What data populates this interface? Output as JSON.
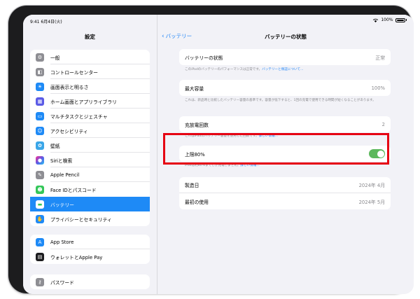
{
  "status_bar": {
    "time": "9:41  6月4日(火)",
    "battery": "100%"
  },
  "sidebar": {
    "title": "設定",
    "groups": [
      [
        {
          "label": "一般",
          "icon": "gear-icon",
          "color": "#8e8e93"
        },
        {
          "label": "コントロールセンター",
          "icon": "control-center-icon",
          "color": "#8e8e93"
        },
        {
          "label": "画面表示と明るさ",
          "icon": "brightness-icon",
          "color": "#1e8af6"
        },
        {
          "label": "ホーム画面とアプリライブラリ",
          "icon": "home-screen-icon",
          "color": "#5b5be6"
        },
        {
          "label": "マルチタスクとジェスチャ",
          "icon": "multitask-icon",
          "color": "#1e8af6"
        },
        {
          "label": "アクセシビリティ",
          "icon": "accessibility-icon",
          "color": "#1e8af6"
        },
        {
          "label": "壁紙",
          "icon": "wallpaper-icon",
          "color": "#3aa6e8"
        },
        {
          "label": "Siriと検索",
          "icon": "siri-icon",
          "color": "#2a2a36"
        },
        {
          "label": "Apple Pencil",
          "icon": "pencil-icon",
          "color": "#8e8e93"
        },
        {
          "label": "Face IDとパスコード",
          "icon": "face-id-icon",
          "color": "#34c759"
        },
        {
          "label": "バッテリー",
          "icon": "battery-icon",
          "color": "#34c759"
        },
        {
          "label": "プライバシーとセキュリティ",
          "icon": "privacy-hand-icon",
          "color": "#1e8af6"
        }
      ],
      [
        {
          "label": "App Store",
          "icon": "app-store-icon",
          "color": "#1e8af6"
        },
        {
          "label": "ウォレットとApple Pay",
          "icon": "wallet-icon",
          "color": "#1c1c1e"
        }
      ],
      [
        {
          "label": "パスワード",
          "icon": "key-icon",
          "color": "#8e8e93"
        }
      ]
    ]
  },
  "detail": {
    "back_label": "バッテリー",
    "title": "バッテリーの状態",
    "battery_state": {
      "label": "バッテリーの状態",
      "value": "正常",
      "note": "このiPadのバッテリーのパフォーマンスは正常です。",
      "note_link": "バッテリーと保証について..."
    },
    "max_capacity": {
      "label": "最大容量",
      "value": "100%",
      "note": "これは、新品時と比較したバッテリー容量の基準です。容量が低下すると、1回の充電で使用できる時間が短くなることがあります。"
    },
    "cycle_count": {
      "label": "充放電回数",
      "value": "2",
      "note": "これはiPadのバッテリー容量を使用した回数です。",
      "note_link": "詳しい情報..."
    },
    "limit": {
      "label": "上限80%",
      "enabled": true,
      "note": "iPadは約80%までしか充電しません。",
      "note_link": "詳しい情報..."
    },
    "manufacture": {
      "label": "製造日",
      "value": "2024年 4月"
    },
    "first_use": {
      "label": "最初の使用",
      "value": "2024年 5月"
    }
  },
  "colors": {
    "accent": "#1a82f7",
    "toggle_on": "#5cb85c",
    "highlight": "#e60012",
    "selected": "#1e8af6"
  }
}
